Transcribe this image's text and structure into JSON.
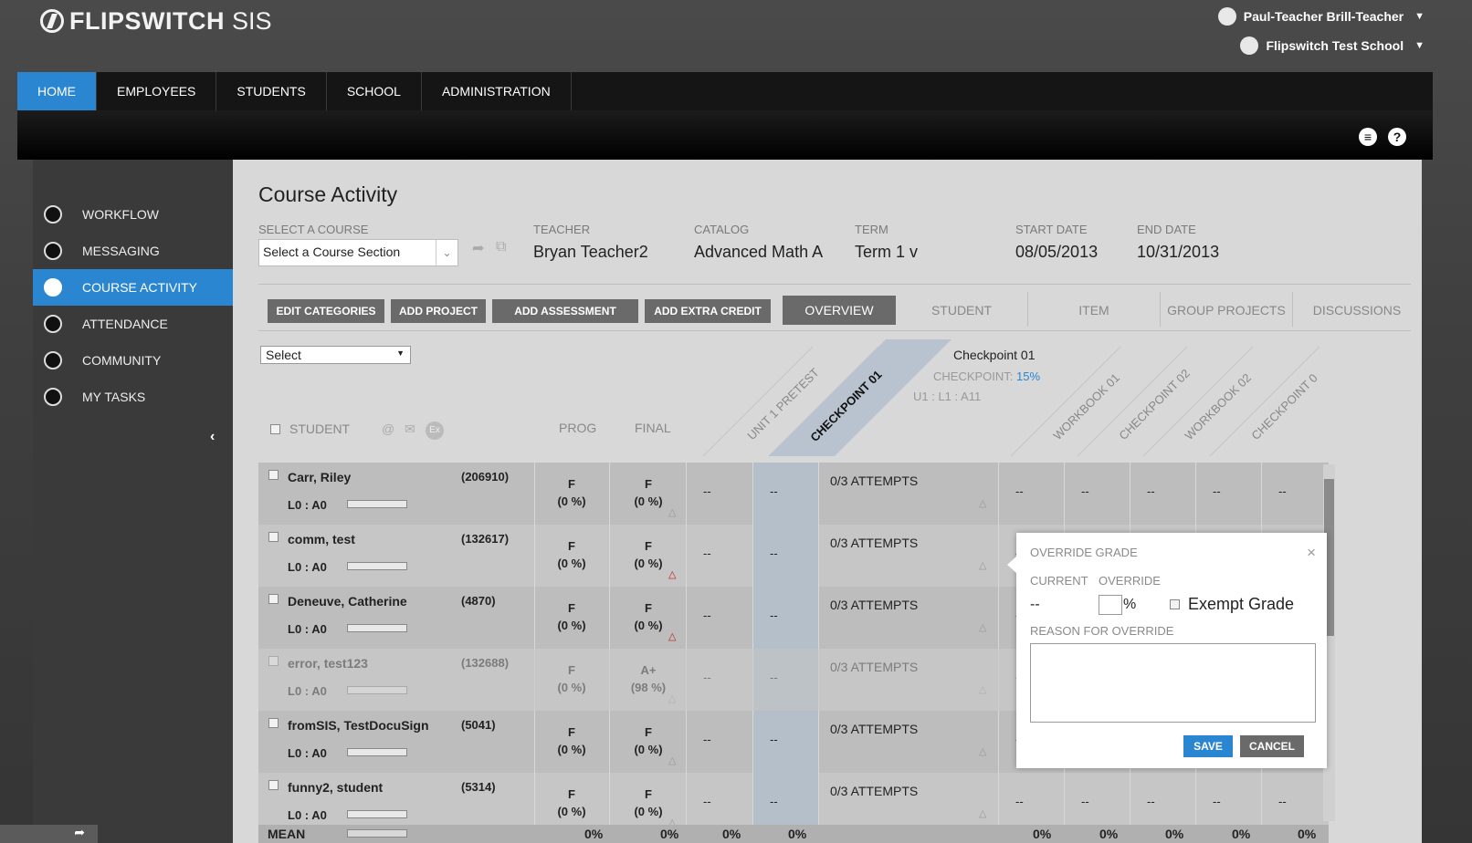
{
  "app": {
    "name": "FLIPSWITCH",
    "suffix": "SIS"
  },
  "user": {
    "name": "Paul-Teacher Brill-Teacher",
    "school": "Flipswitch Test School"
  },
  "nav": {
    "items": [
      "HOME",
      "EMPLOYEES",
      "STUDENTS",
      "SCHOOL",
      "ADMINISTRATION"
    ],
    "active": "HOME"
  },
  "sidebar": {
    "items": [
      "WORKFLOW",
      "MESSAGING",
      "COURSE ACTIVITY",
      "ATTENDANCE",
      "COMMUNITY",
      "MY TASKS"
    ],
    "active": "COURSE ACTIVITY"
  },
  "page": {
    "title": "Course Activity",
    "select_course_label": "SELECT A COURSE",
    "select_course_value": "Select a Course Section",
    "teacher_label": "TEACHER",
    "teacher": "Bryan Teacher2",
    "catalog_label": "CATALOG",
    "catalog": "Advanced Math A",
    "term_label": "TERM",
    "term": "Term 1 v",
    "start_label": "START DATE",
    "start": "08/05/2013",
    "end_label": "END DATE",
    "end": "10/31/2013"
  },
  "toolbar": {
    "buttons": [
      "EDIT CATEGORIES",
      "ADD PROJECT",
      "ADD ASSESSMENT",
      "ADD EXTRA CREDIT"
    ]
  },
  "tabs": {
    "items": [
      "OVERVIEW",
      "STUDENT",
      "ITEM",
      "GROUP PROJECTS",
      "DISCUSSIONS"
    ],
    "active": "OVERVIEW"
  },
  "filter": {
    "value": "Select"
  },
  "grid": {
    "col_student": "STUDENT",
    "col_prog": "PROG",
    "col_final": "FINAL",
    "hdr_icons": [
      "@",
      "✉",
      "Ex"
    ],
    "assignment_columns": [
      "UNIT 1 PRETEST",
      "CHECKPOINT 01",
      "WORKBOOK 01",
      "CHECKPOINT 02",
      "WORKBOOK 02",
      "CHECKPOINT 0"
    ],
    "selected_detail": {
      "name": "Checkpoint 01",
      "category": "CHECKPOINT:",
      "weight": "15%",
      "code": "U1 : L1 : A11"
    },
    "rows": [
      {
        "name": "Carr, Riley",
        "id": "(206910)",
        "level": "L0 : A0",
        "prog": "F",
        "prog_pct": "(0 %)",
        "final": "F",
        "final_pct": "(0 %)",
        "attempts": "0/3 ATTEMPTS",
        "flag": false
      },
      {
        "name": "comm, test",
        "id": "(132617)",
        "level": "L0 : A0",
        "prog": "F",
        "prog_pct": "(0 %)",
        "final": "F",
        "final_pct": "(0 %)",
        "attempts": "0/3 ATTEMPTS",
        "flag": true
      },
      {
        "name": "Deneuve, Catherine",
        "id": "(4870)",
        "level": "L0 : A0",
        "prog": "F",
        "prog_pct": "(0 %)",
        "final": "F",
        "final_pct": "(0 %)",
        "attempts": "0/3 ATTEMPTS",
        "flag": true
      },
      {
        "name": "error, test123",
        "id": "(132688)",
        "level": "L0 : A0",
        "prog": "F",
        "prog_pct": "(0 %)",
        "final": "A+",
        "final_pct": "(98 %)",
        "attempts": "0/3 ATTEMPTS",
        "flag": false,
        "disabled": true
      },
      {
        "name": "fromSIS, TestDocuSign",
        "id": "(5041)",
        "level": "L0 : A0",
        "prog": "F",
        "prog_pct": "(0 %)",
        "final": "F",
        "final_pct": "(0 %)",
        "attempts": "0/3 ATTEMPTS",
        "flag": false
      },
      {
        "name": "funny2, student",
        "id": "(5314)",
        "level": "L0 : A0",
        "prog": "F",
        "prog_pct": "(0 %)",
        "final": "F",
        "final_pct": "(0 %)",
        "attempts": "0/3 ATTEMPTS",
        "flag": false
      }
    ],
    "empty_value": "--",
    "mean": {
      "label": "MEAN",
      "prog": "0%",
      "final": "0%",
      "values": [
        "0%",
        "0%",
        "0%",
        "0%",
        "0%",
        "0%",
        "0%"
      ]
    }
  },
  "override": {
    "title": "OVERRIDE GRADE",
    "current_label": "CURRENT",
    "override_label": "OVERRIDE",
    "current_value": "--",
    "override_value": "",
    "pct": "%",
    "exempt_label": "Exempt Grade",
    "reason_label": "REASON FOR OVERRIDE",
    "save": "SAVE",
    "cancel": "CANCEL",
    "close": "×"
  },
  "colors": {
    "accent": "#2b86d2",
    "alert": "#c01a1a",
    "weight": "#2b86d2"
  },
  "icons": [
    "logo-icon",
    "user-icon",
    "school-icon",
    "chat-icon",
    "help-icon",
    "share-icon",
    "collapse-icon"
  ]
}
